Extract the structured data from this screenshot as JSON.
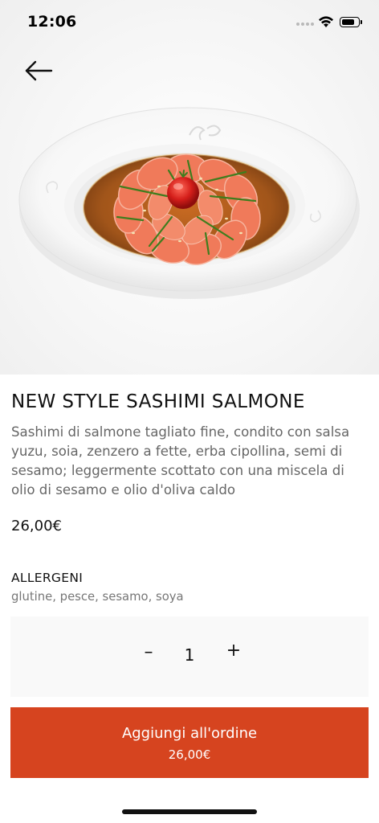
{
  "status_bar": {
    "time": "12:06"
  },
  "icons": {
    "back": "arrow-left-icon",
    "wifi": "wifi-icon",
    "battery": "battery-icon",
    "signal": "cellular-signal-icon"
  },
  "hero": {
    "image": "salmon-sashimi-plate"
  },
  "product": {
    "title": "NEW STYLE SASHIMI SALMONE",
    "description": "Sashimi di salmone tagliato fine, condito con salsa yuzu, soia, zenzero a fette, erba cipollina, semi di sesamo; leggermente scottato con una miscela di olio di sesamo e olio d'oliva caldo",
    "price": "26,00€"
  },
  "allergens": {
    "heading": "ALLERGENI",
    "list": "glutine, pesce, sesamo, soya"
  },
  "quantity": {
    "minus": "–",
    "value": "1",
    "plus": "+"
  },
  "add_to_order": {
    "label": "Aggiungi all'ordine",
    "price": "26,00€"
  },
  "colors": {
    "accent": "#d6441f",
    "text": "#111111",
    "muted": "#666666"
  }
}
